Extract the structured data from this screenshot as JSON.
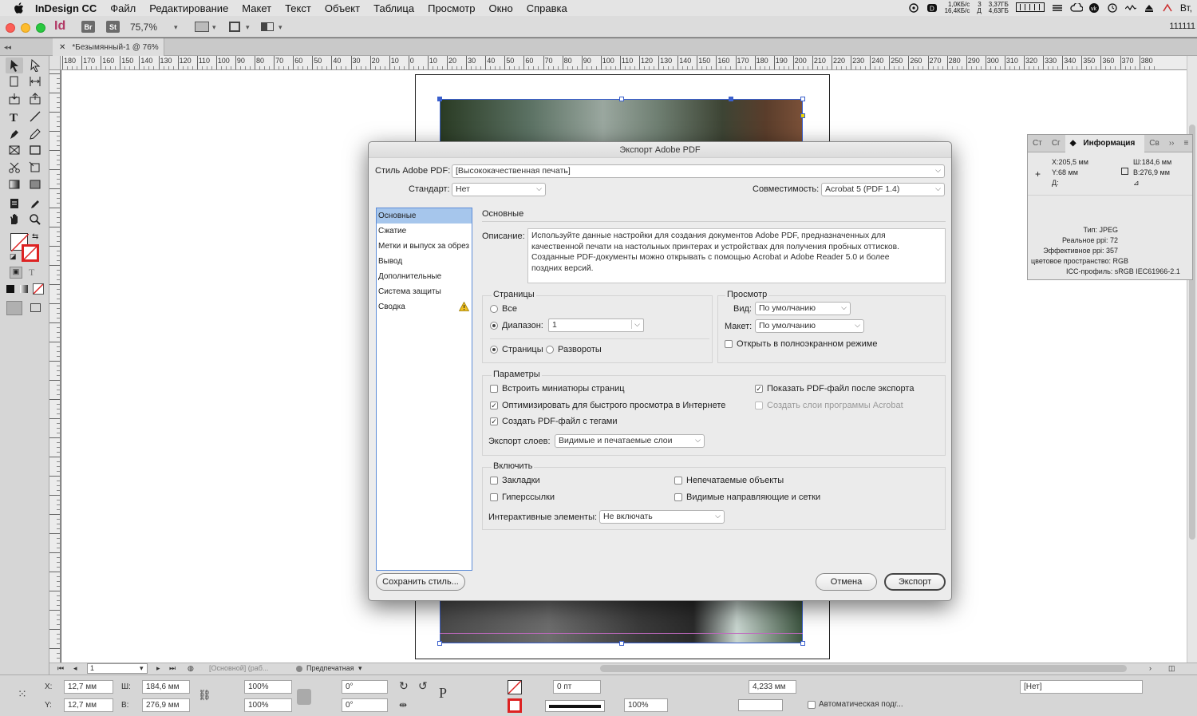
{
  "menubar": {
    "app": "InDesign CC",
    "items": [
      "Файл",
      "Редактирование",
      "Макет",
      "Текст",
      "Объект",
      "Таблица",
      "Просмотр",
      "Окно",
      "Справка"
    ],
    "net_up": "1,0КБ/с",
    "net_down": "16,4КБ/с",
    "disk_top": "3,37ГБ",
    "disk_bottom": "4,63ГБ",
    "disk_label_top": "3",
    "disk_label_bottom": "Д",
    "day": "Вт,"
  },
  "controlbar": {
    "app_badge": "Id",
    "br": "Br",
    "st": "St",
    "zoom": "75,7%",
    "right_text": "111111"
  },
  "document": {
    "tab_title": "*Безымянный-1 @ 76%"
  },
  "ruler": {
    "labels": [
      "180",
      "170",
      "160",
      "150",
      "140",
      "130",
      "120",
      "110",
      "100",
      "90",
      "80",
      "70",
      "60",
      "50",
      "40",
      "30",
      "20",
      "10",
      "0",
      "10",
      "20",
      "30",
      "40",
      "50",
      "60",
      "70",
      "80",
      "90",
      "100",
      "110",
      "120",
      "130",
      "140",
      "150",
      "160",
      "170",
      "180",
      "190",
      "200",
      "210",
      "220",
      "230",
      "240",
      "250",
      "260",
      "270",
      "280",
      "290",
      "300",
      "310",
      "320",
      "330",
      "340",
      "350",
      "360",
      "370",
      "380"
    ]
  },
  "info_panel": {
    "tabs": [
      "Ст",
      "Сг",
      "Информация",
      "Св"
    ],
    "x": "X:205,5 мм",
    "y": "Y:68 мм",
    "d": "Д:",
    "w": "Ш:184,6 мм",
    "h": "В:276,9 мм",
    "type": "Тип: JPEG",
    "real_ppi": "Реальное ppi: 72",
    "eff_ppi": "Эффективное ppi: 357",
    "color_space": "цветовое пространство: RGB",
    "icc": "ICC-профиль: sRGB IEC61966-2.1"
  },
  "dialog": {
    "title": "Экспорт Adobe PDF",
    "style_label": "Стиль Adobe PDF:",
    "style_value": "[Высококачественная печать]",
    "standard_label": "Стандарт:",
    "standard_value": "Нет",
    "compat_label": "Совместимость:",
    "compat_value": "Acrobat 5 (PDF 1.4)",
    "nav": [
      "Основные",
      "Сжатие",
      "Метки и выпуск за обрез",
      "Вывод",
      "Дополнительные",
      "Система защиты",
      "Сводка"
    ],
    "section_title": "Основные",
    "desc_label": "Описание:",
    "desc_lines": [
      "Используйте данные настройки для создания документов Adobe PDF, предназначенных для",
      "качественной печати на настольных принтерах и устройствах для получения пробных оттисков.",
      "Созданные PDF-документы можно  открывать с помощью Acrobat и Adobe Reader 5.0 и более",
      "поздних версий."
    ],
    "pages": {
      "title": "Страницы",
      "all": "Все",
      "range": "Диапазон:",
      "range_value": "1",
      "pages": "Страницы",
      "spreads": "Развороты"
    },
    "view": {
      "title": "Просмотр",
      "view_label": "Вид:",
      "view_value": "По умолчанию",
      "layout_label": "Макет:",
      "layout_value": "По умолчанию",
      "fullscreen": "Открыть в полноэкранном режиме"
    },
    "params": {
      "title": "Параметры",
      "embed_thumbs": "Встроить миниатюры страниц",
      "optimize": "Оптимизировать для быстрого просмотра в Интернете",
      "tagged": "Создать PDF-файл с тегами",
      "show_after": "Показать PDF-файл после экспорта",
      "acrobat_layers": "Создать слои программы Acrobat",
      "export_layers_label": "Экспорт слоев:",
      "export_layers_value": "Видимые и печатаемые слои"
    },
    "include": {
      "title": "Включить",
      "bookmarks": "Закладки",
      "hyperlinks": "Гиперссылки",
      "nonprinting": "Непечатаемые объекты",
      "guides": "Видимые направляющие и сетки",
      "interactive_label": "Интерактивные элементы:",
      "interactive_value": "Не включать"
    },
    "save_style": "Сохранить стиль...",
    "cancel": "Отмена",
    "export": "Экспорт"
  },
  "statusbar": {
    "page": "1",
    "master": "[Основной] (раб...",
    "preflight": "Предпечатная"
  },
  "propbar": {
    "x_label": "X:",
    "x": "12,7 мм",
    "y_label": "Y:",
    "y": "12,7 мм",
    "w_label": "Ш:",
    "w": "184,6 мм",
    "h_label": "В:",
    "h": "276,9 мм",
    "scale_x": "100%",
    "scale_y": "100%",
    "angle": "0°",
    "shear": "0°",
    "stroke": "0 пт",
    "opacity": "100%",
    "gap": "4,233 мм",
    "style": "[Нет]",
    "autofit": "Автоматическая подг..."
  },
  "colors": {
    "accent": "#3a5fcd",
    "nav_selected": "#a6c6ec",
    "id_brand": "#b23a66"
  }
}
